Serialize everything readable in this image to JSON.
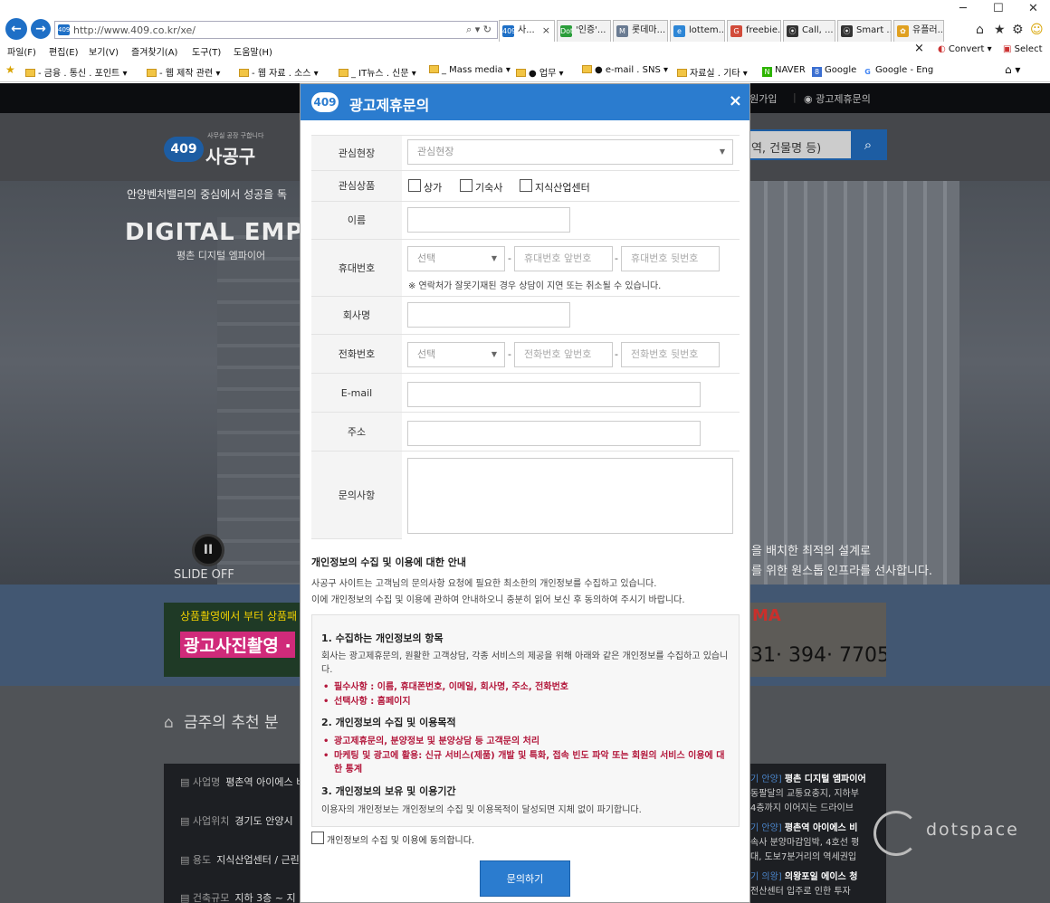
{
  "browser": {
    "address_url": "http://www.409.co.kr/xe/",
    "address_tools": "⌕ ▾ ↻",
    "favicon_text": "409",
    "tabs": [
      {
        "label": "사...",
        "icon_text": "409",
        "color": "#1e6fc6",
        "active": true
      },
      {
        "label": "'인증'...",
        "icon_text": "Dot",
        "color": "#2a9d3a"
      },
      {
        "label": "롯데마...",
        "icon_text": "M",
        "color": "#6a7b92"
      },
      {
        "label": "lottem...",
        "icon_text": "e",
        "color": "#2d86d6"
      },
      {
        "label": "freebie...",
        "icon_text": "G",
        "color": "#d14b3a"
      },
      {
        "label": "Call, ...",
        "icon_text": "⦿",
        "color": "#333333"
      },
      {
        "label": "Smart ...",
        "icon_text": "⦿",
        "color": "#333333"
      },
      {
        "label": "유플러...",
        "icon_text": "✿",
        "color": "#e0a020"
      }
    ],
    "window_controls": [
      "─",
      "☐",
      "✕"
    ],
    "right_tools": [
      "⌂",
      "★",
      "⚙",
      "☺"
    ]
  },
  "menubar": {
    "items": [
      "파일(F)",
      "편집(E)",
      "보기(V)",
      "즐겨찾기(A)",
      "도구(T)",
      "도움말(H)"
    ],
    "close": "×",
    "convert": "Convert",
    "select": "Select"
  },
  "favorites": [
    "- 금융 . 통신 . 포인트 ▾",
    "- 웹 제작 관련 ▾",
    "- 웹 자료 . 소스 ▾",
    "_ IT뉴스 . 신문 ▾",
    "_ Mass media ▾",
    "● 업무 ▾",
    "● e-mail . SNS ▾",
    "자료실 . 기타 ▾"
  ],
  "favorites_links": [
    {
      "label": "NAVER",
      "icon": "N",
      "color": "#2db400"
    },
    {
      "label": "Google",
      "icon": "8",
      "color": "#3b6fd1"
    },
    {
      "label": "Google - Eng",
      "icon": "G",
      "color": "#4285f4"
    }
  ],
  "favorites_right": "⌂ ▾",
  "site": {
    "top_links": [
      "회원가입",
      "광고제휴문의"
    ],
    "top_links_icons": [
      "",
      "👁"
    ],
    "logo_badge": "409",
    "logo_name": "사공구",
    "logo_sub": "사무실 공장 구합니다",
    "search_placeholder": "철역, 건물명 등)",
    "search_icon": "⌕",
    "hero_line1": "안양벤처밸리의 중심에서 성공을 독",
    "hero_title": "DIGITAL EMPI",
    "hero_sub": "평촌 디지털 엠파이어",
    "hero_right1": "을 배치한 최적의 설계로",
    "hero_right2": "를 위한 원스톱 인프라를 선사합니다.",
    "pause_icon": "II",
    "slide_off": "SLIDE OFF",
    "banner1_line1": "상품촬영에서 부터 상품패",
    "banner1_line2": "광고사진촬영 ·",
    "banner2_phone": "31· 394· 7705",
    "banner2_logo": "MA",
    "weekly_title": "금주의 추천 분",
    "weekly_icon": "⌂",
    "left_rows": [
      {
        "key": "사업명",
        "val": "평촌역 아이에스 비"
      },
      {
        "key": "사업위치",
        "val": "경기도 안양시"
      },
      {
        "key": "용도",
        "val": "지식산업센터 / 근린"
      },
      {
        "key": "건축규모",
        "val": "지하 3층 ~ 지"
      }
    ],
    "right_rows": [
      {
        "label": "기 안양]",
        "title": "평촌 디지털 엠파이어",
        "lines": [
          "동팔달의 교통요충지, 지하부",
          "4층까지 이어지는 드라이브"
        ]
      },
      {
        "label": "기 안양]",
        "title": "평촌역 아이에스 비",
        "lines": [
          "속사 분양마감임박, 4호선 평",
          "대, 도보7분거리의 역세권입"
        ]
      },
      {
        "label": "기 의왕]",
        "title": "의왕포일 에이스 청",
        "lines": [
          "전산센터 입주로 인한 투자"
        ]
      }
    ],
    "watermark": "dotspace"
  },
  "modal": {
    "logo": "409",
    "title": "광고제휴문의",
    "close": "×",
    "labels": {
      "interest_site": "관심현장",
      "interest_product": "관심상품",
      "name": "이름",
      "mobile": "휴대번호",
      "company": "회사명",
      "phone": "전화번호",
      "email": "E-mail",
      "address": "주소",
      "inquiry": "문의사항"
    },
    "interest_site_placeholder": "관심현장",
    "products": [
      "상가",
      "기숙사",
      "지식산업센터"
    ],
    "select_placeholder": "선택",
    "mobile_front_placeholder": "휴대번호 앞번호",
    "mobile_back_placeholder": "휴대번호 뒷번호",
    "mobile_note": "※ 연락처가 잘못기재된 경우 상담이 지연 또는 취소될 수 있습니다.",
    "phone_front_placeholder": "전화번호 앞번호",
    "phone_back_placeholder": "전화번호 뒷번호",
    "dash": "-",
    "caret": "▼",
    "privacy_heading": "개인정보의 수집 및 이용에 대한 안내",
    "privacy_intro1": "사공구 사이트는 고객님의 문의사항 요청에 필요한 최소한의 개인정보를 수집하고 있습니다.",
    "privacy_intro2": "이에 개인정보의 수집 및 이용에 관하여 안내하오니 충분히 읽어 보신 후 동의하여 주시기 바랍니다.",
    "sec1_title": "1. 수집하는 개인정보의 항목",
    "sec1_text": "회사는 광고제휴문의, 원활한 고객상담, 각종 서비스의 제공을 위해 아래와 같은 개인정보를 수집하고 있습니다.",
    "sec1_required": "필수사항 : 이름, 휴대폰번호, 이메일, 회사명, 주소, 전화번호",
    "sec1_optional": "선택사항 : 홈페이지",
    "sec2_title": "2. 개인정보의 수집 및 이용목적",
    "sec2_item1": "광고제휴문의, 분양정보 및 분양상담 등 고객문의 처리",
    "sec2_item2": "마케팅 및 광고에 활용: 신규 서비스(제품) 개발 및 특화, 접속 빈도 파악 또는 회원의 서비스 이용에 대한 통계",
    "sec3_title": "3. 개인정보의 보유 및 이용기간",
    "sec3_text": "이용자의 개인정보는 개인정보의 수집 및 이용목적이 달성되면 지체 없이 파기합니다.",
    "agree_label": "개인정보의 수집 및 이용에 동의합니다.",
    "submit": "문의하기"
  }
}
